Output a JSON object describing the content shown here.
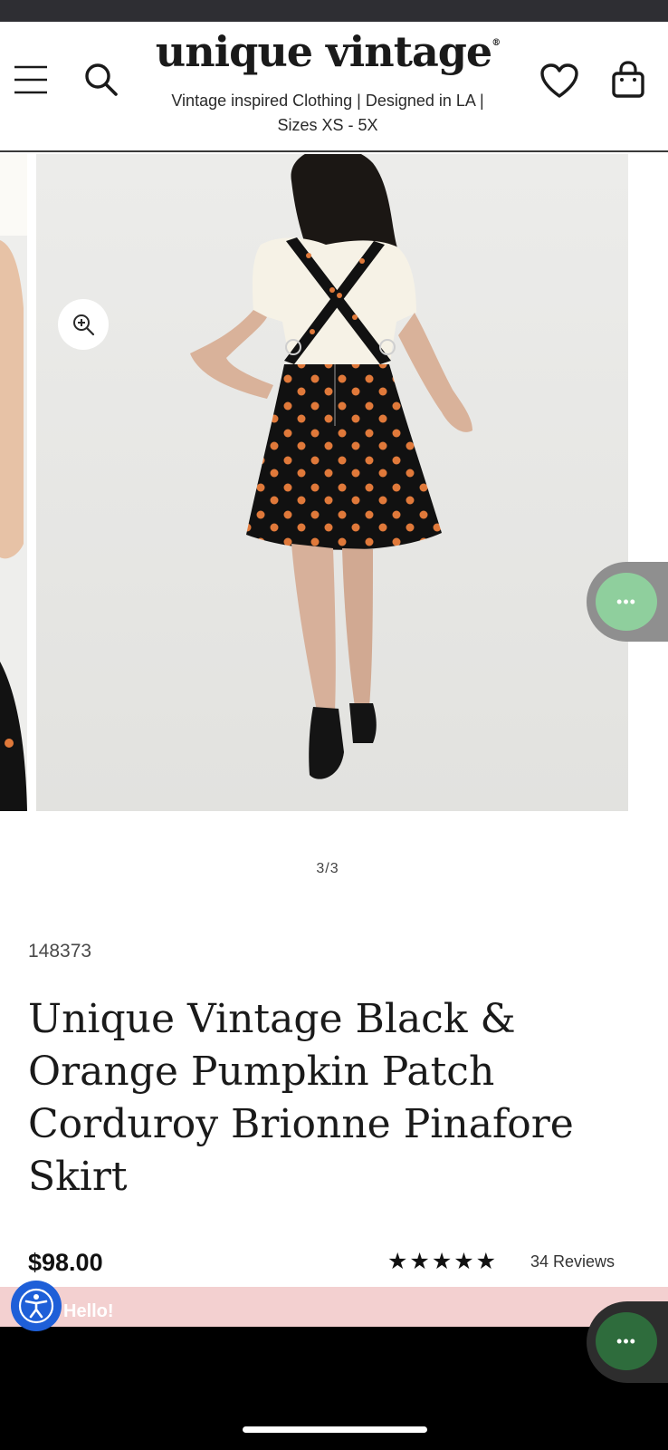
{
  "brand": {
    "logo_text": "unique vintage",
    "registered_mark": "®",
    "tagline": "Vintage inspired Clothing | Designed in LA | Sizes XS - 5X"
  },
  "header": {
    "icons": [
      "menu-icon",
      "search-icon",
      "heart-icon",
      "shopping-bag-icon"
    ]
  },
  "gallery": {
    "counter": "3/3",
    "zoom_icon": "zoom-in-icon"
  },
  "product": {
    "sku": "148373",
    "title": "Unique Vintage Black & Orange Pumpkin Patch Corduroy Brionne Pinafore Skirt",
    "price": "$98.00",
    "rating_stars": "★★★★★",
    "rating_value": 5,
    "reviews_label": "34 Reviews"
  },
  "promo": {
    "text": "Hello!"
  },
  "chat": {
    "icon": "more-dots-icon",
    "dots": "•••"
  },
  "accessibility": {
    "icon": "accessibility-icon"
  },
  "colors": {
    "status_bar": "#2e2e33",
    "chat_green": "#8fcf9d",
    "chat_green_dark": "#2e6c3c",
    "promo_pink": "#f3d0d0",
    "accessibility_blue": "#1e5fd8",
    "skirt_black": "#111111",
    "pumpkin_orange": "#e0793a"
  }
}
